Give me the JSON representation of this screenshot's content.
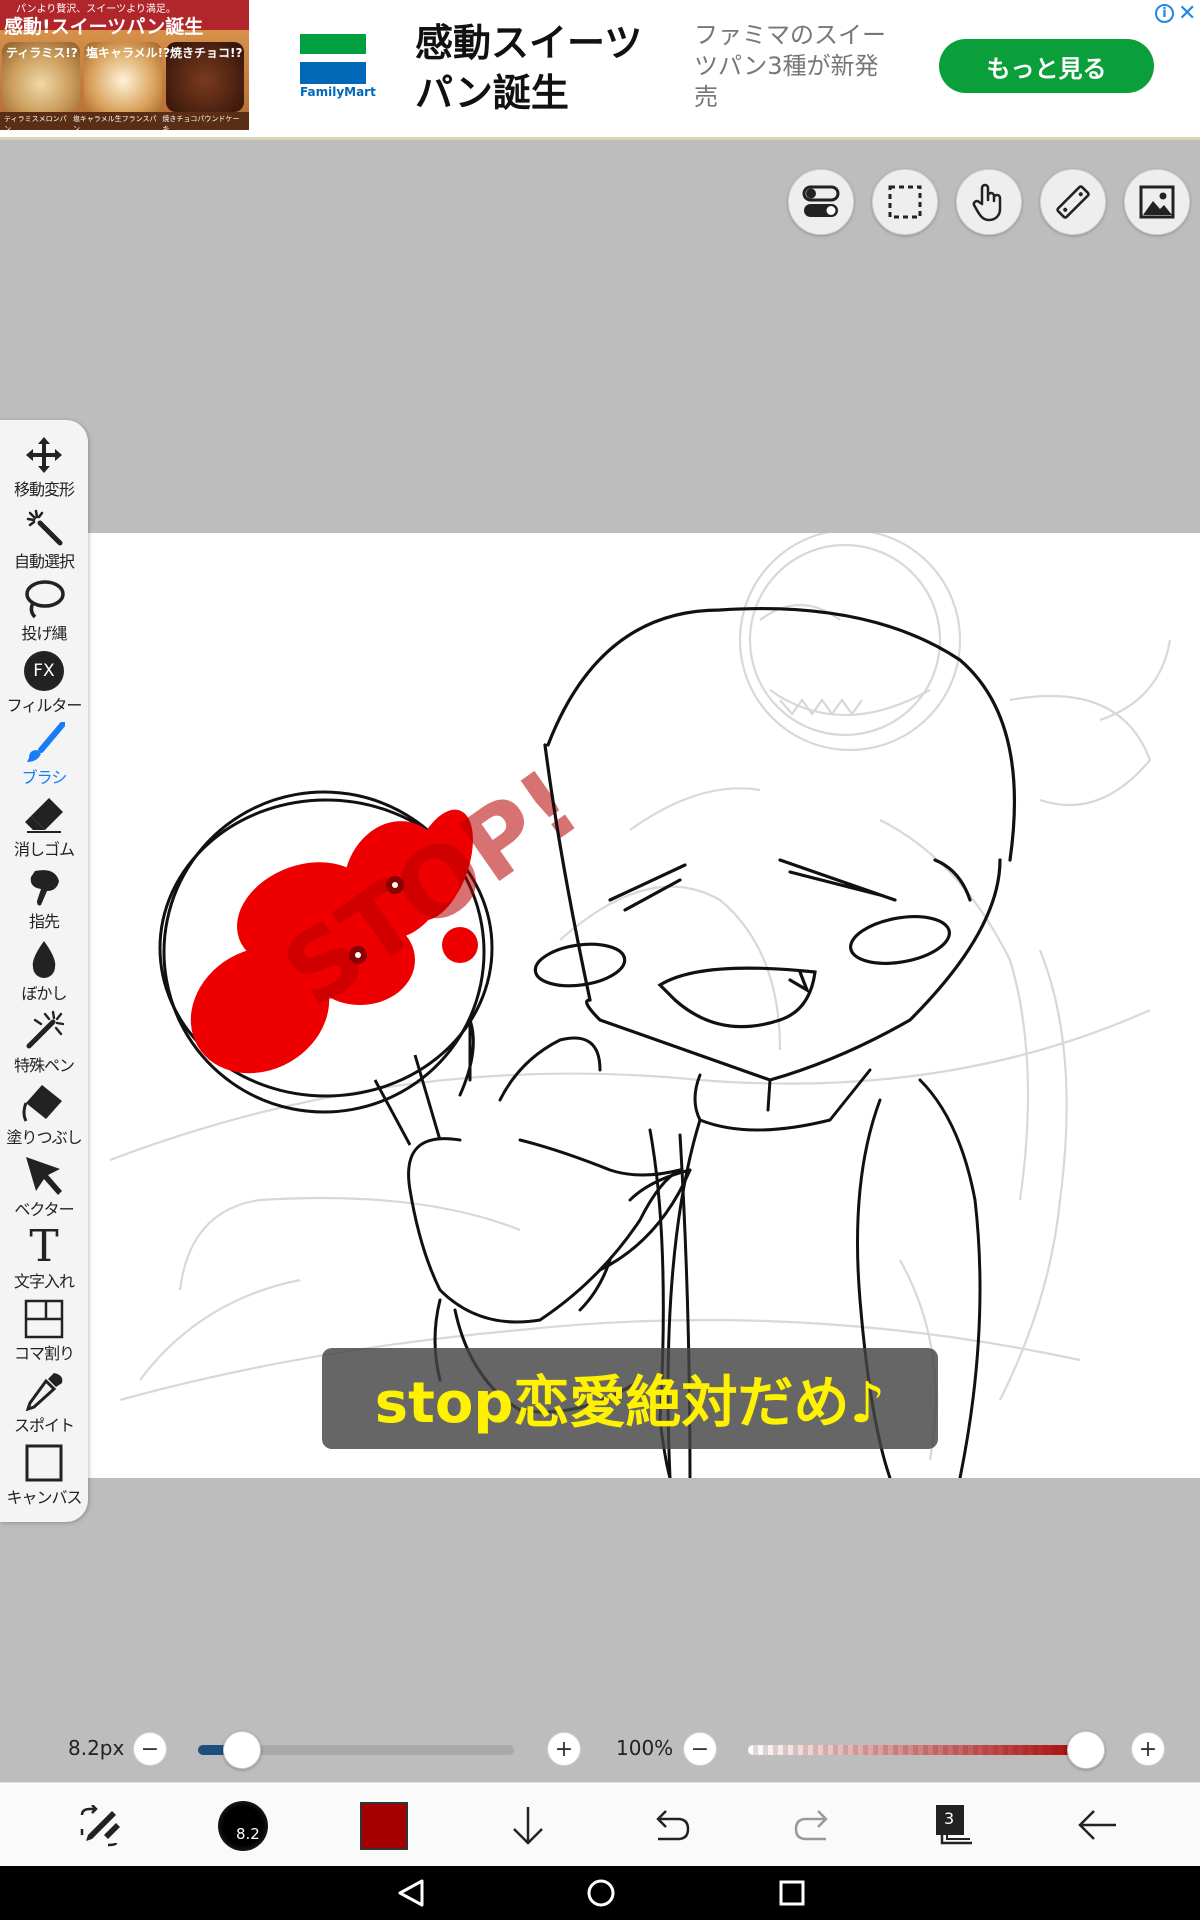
{
  "ad": {
    "image_top": "パンより贅沢、スイーツより満足。",
    "image_headline": "感動!スイーツパン誕生",
    "image_tags": [
      "ティラミス!?",
      "塩キャラメル!?",
      "焼きチョコ!?"
    ],
    "image_captions": [
      "ティラミスメロンパン",
      "塩キャラメル生フランスパン",
      "焼きチョコパウンドケーキ"
    ],
    "brand": "FamilyMart",
    "headline": "感動スイーツパン誕生",
    "description": "ファミマのスイーツパン3種が新発売",
    "cta": "もっと見る",
    "info_icon": "i",
    "close_icon": "✕"
  },
  "top_tools": [
    "toggle-icon",
    "selection-icon",
    "hand-icon",
    "ruler-icon",
    "image-icon"
  ],
  "tools": [
    {
      "label": "移動変形",
      "icon": "move-icon"
    },
    {
      "label": "自動選択",
      "icon": "magic-wand-icon"
    },
    {
      "label": "投げ縄",
      "icon": "lasso-icon"
    },
    {
      "label": "フィルター",
      "icon": "fx-icon"
    },
    {
      "label": "ブラシ",
      "icon": "brush-icon",
      "active": true
    },
    {
      "label": "消しゴム",
      "icon": "eraser-icon"
    },
    {
      "label": "指先",
      "icon": "finger-icon"
    },
    {
      "label": "ぼかし",
      "icon": "blur-icon"
    },
    {
      "label": "特殊ペン",
      "icon": "special-pen-icon"
    },
    {
      "label": "塗りつぶし",
      "icon": "bucket-icon"
    },
    {
      "label": "ベクター",
      "icon": "vector-icon"
    },
    {
      "label": "文字入れ",
      "icon": "text-icon"
    },
    {
      "label": "コマ割り",
      "icon": "frame-icon"
    },
    {
      "label": "スポイト",
      "icon": "eyedropper-icon"
    },
    {
      "label": "キャンバス",
      "icon": "canvas-icon"
    }
  ],
  "fx_text": "FX",
  "text_icon_glyph": "T",
  "canvas": {
    "sign_text": "STOP!",
    "caption": "stop恋愛絶対だめ♪"
  },
  "brush": {
    "size_label": "8.2px",
    "size_value": 8.2,
    "size_fraction": 0.14,
    "opacity_label": "100%",
    "opacity_fraction": 1.0,
    "minus": "−",
    "plus": "+"
  },
  "bottom_bar": {
    "brush_size_badge": "8.2",
    "color": "#a50000",
    "layer_count": "3"
  },
  "colors": {
    "accent": "#1a7cf5",
    "slider_fill": "#1d4f7d",
    "brush_color": "#a50000"
  }
}
